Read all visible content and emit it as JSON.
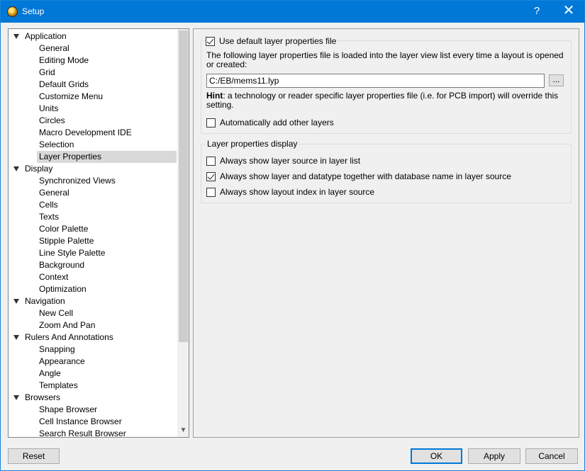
{
  "window": {
    "title": "Setup",
    "help_glyph": "?",
    "close_glyph": "✕"
  },
  "tree": {
    "categories": [
      {
        "label": "Application",
        "children": [
          "General",
          "Editing Mode",
          "Grid",
          "Default Grids",
          "Customize Menu",
          "Units",
          "Circles",
          "Macro Development IDE",
          "Selection",
          "Layer Properties"
        ]
      },
      {
        "label": "Display",
        "children": [
          "Synchronized Views",
          "General",
          "Cells",
          "Texts",
          "Color Palette",
          "Stipple Palette",
          "Line Style Palette",
          "Background",
          "Context",
          "Optimization"
        ]
      },
      {
        "label": "Navigation",
        "children": [
          "New Cell",
          "Zoom And Pan"
        ]
      },
      {
        "label": "Rulers And Annotations",
        "children": [
          "Snapping",
          "Appearance",
          "Angle",
          "Templates"
        ]
      },
      {
        "label": "Browsers",
        "children": [
          "Shape Browser",
          "Cell Instance Browser",
          "Search Result Browser"
        ]
      }
    ],
    "selected": "Layer Properties"
  },
  "layer_file": {
    "use_default_label": "Use default layer properties file",
    "use_default_checked": true,
    "description": "The following layer properties file is loaded into the layer view list every time a layout is opened or created:",
    "path_value": "C:/EB/mems11.lyp",
    "browse_label": "...",
    "hint_bold": "Hint",
    "hint_text": ": a technology or reader specific layer properties file (i.e. for PCB import) will override this setting.",
    "auto_add_label": "Automatically add other layers",
    "auto_add_checked": false
  },
  "display": {
    "group_title": "Layer properties display",
    "options": [
      {
        "label": "Always show layer source in layer list",
        "checked": false
      },
      {
        "label": "Always show layer and datatype together with database name in layer source",
        "checked": true
      },
      {
        "label": "Always show layout index in layer source",
        "checked": false
      }
    ]
  },
  "buttons": {
    "reset": "Reset",
    "ok": "OK",
    "apply": "Apply",
    "cancel": "Cancel"
  }
}
